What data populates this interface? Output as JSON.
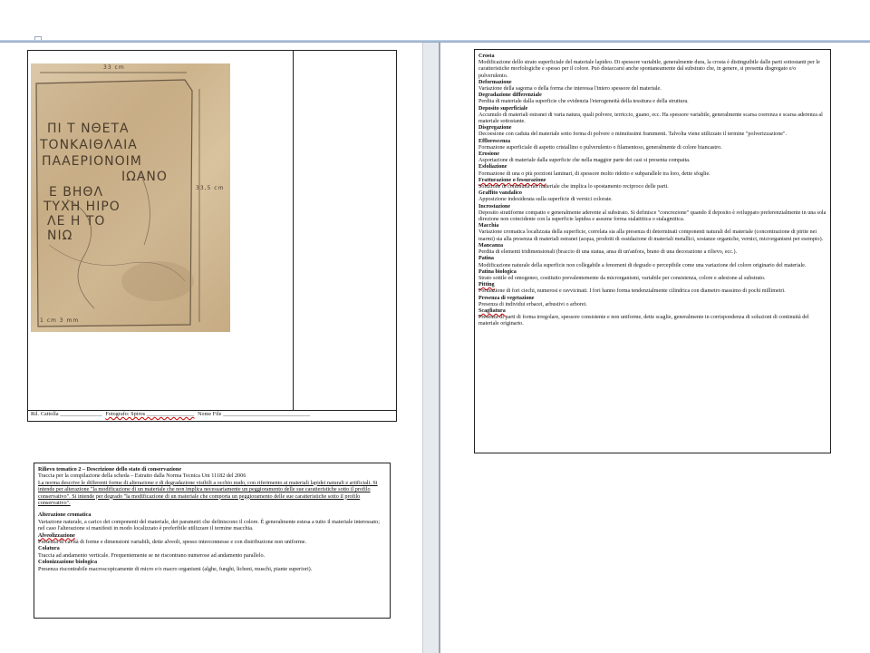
{
  "form": {
    "footer": {
      "ril": "Ril. Cattolla _______________",
      "foto": "Fotografo: Spiros _________________",
      "nome": "Nome File _______________________________"
    }
  },
  "photo": {
    "measure_top": "33 cm",
    "measure_right": "33,5 cm",
    "measure_bottom": "1 cm 3 mm",
    "lines": [
      "ΠΙ Τ ΝΘΕΤΑ",
      "ΤΟΝΚΑΙΘΛΑΙΑ",
      "ΠΑΑΕΡΙΟΝΟΙΜ",
      "ΙΩΑΝΟ",
      "Ε ΒΗΘΛ",
      "ΤΥΧΗ ΗΙΡΟ",
      "ΛΕ Η ΤΟ",
      "ΝΙΩ"
    ]
  },
  "description": {
    "title": "Rilievo tematico 2 – Descrizione dello stato di conservazione",
    "p1": "Traccia per la compilazione della scheda – Estratto dalla Norma Tecnica Uni 11182 del 2006",
    "p2": "La norma descrive le differenti forme di alterazione e di degradazione visibili a occhio nudo,  con riferimento ai materiali lapidei naturali e artificiali. Si intende per alterazione \"la modificazione di un materiale che non implica necessariamente un peggioramento delle sue caratteristiche sotto il profilo conservativo\". Si intende per degrado \"la modificazione di un materiale che comporta un peggioramento delle sue caratteristiche sotto il profilo conservativo\".",
    "items": [
      {
        "term": "Alterazione cromatica",
        "def": "Variazione naturale, a carico dei componenti del materiale, dei parametri che definiscono il colore.  È generalmente estesa a tutto il materiale interessato; nel caso l'alterazione si manifesti in modo localizzato è preferibile utilizzare il termine macchia."
      },
      {
        "term": "Alveolizzazione",
        "def": "Presenza di cavità di forme e dimensioni variabili, dette alveoli, spesso interconnesse e con distribuzione non uniforme."
      },
      {
        "term": "Colatura",
        "def": "Traccia ad andamento verticale. Frequentemente se ne riscontrano numerose ad andamento parallelo."
      },
      {
        "term": "Colonizzazione biologica",
        "def": "Presenza riscontrabile macroscopicamente di micro e/o macro organismi (alghe, funghi, licheni, muschi, piante superiori)."
      }
    ]
  },
  "glossary": [
    {
      "term": "Crosta",
      "def": "Modificazione dello strato superficiale del materiale lapideo. Di spessore variabile,  generalmente dura, la crosta è distinguibile dalle parti sottostanti per le caratteristiche morfologiche e spesso per il colore. Può distaccarsi anche spontaneamente dal substrato che, in genere, si presenta disgregato e/o pulverulento."
    },
    {
      "term": "Deformazione",
      "def": "Variazione della sagoma o della forma che interessa l'intero spessore del materiale."
    },
    {
      "term": "Degradazione differenziale",
      "def": "Perdita di materiale dalla superficie che evidenzia l'eterogeneità della tessitura e della struttura."
    },
    {
      "term": "Deposito superficiale",
      "def": "Accumulo di materiali estranei di varia natura, quali polvere, terriccio, guano, ecc. Ha spessore variabile, generalmente scarsa coerenza e scarsa aderenza al materiale sottostante."
    },
    {
      "term": "Disgregazione",
      "def": "Decoesione con caduta del materiale sotto forma di polvere o minutissimi frammenti. Talvolta viene utilizzato il termine \"polverizzazione\"."
    },
    {
      "term": "Efflorescenza",
      "def": "Formazione superficiale di aspetto cristallino o pulverulento o filamentoso, generalmente di colore biancastro."
    },
    {
      "term": "Erosione",
      "def": "Asportazione di materiale dalla superficie che nella maggior parte dei casi si presenta compatta."
    },
    {
      "term": "Esfoliazione",
      "def": "Formazione di una o più porzioni laminari, di spessore molto ridotto e subparallele tra loro, dette sfoglie."
    },
    {
      "term": "Fratturazione o fessurazione",
      "def": "Soluzione di continuità nel materiale che implica lo spostamento reciproco delle parti."
    },
    {
      "term": "Graffito vandalico",
      "def": "Apposizione indesiderata sulla superficie di vernici colorate."
    },
    {
      "term": "Incrostazione",
      "def": "Deposito stratiforme compatto e generalmente aderente al substrato. Si definisce \"concrezione\" quando il deposito è sviluppato preferenzialmente in una sola direzione non coincidente con la superficie lapidea e assume forma stalattitica o stalagmitica."
    },
    {
      "term": "Macchia",
      "def": "Variazione cromatica localizzata della superficie, correlata sia alla presenza di determinati componenti naturali del materiale (concentrazione di pirite nei marmi) sia alla presenza di materiali estranei (acqua, prodotti di ossidazione di materiali metallici, sostanze organiche, vernici, microrganismi per esempio)."
    },
    {
      "term": "Mancanza",
      "def": "Perdita di elementi tridimensionali (braccio di una statua, ansa di un'anfora, brano di una decorazione a rilievo, ecc.)."
    },
    {
      "term": "Patina",
      "def": "Modificazione naturale della superficie non collegabile a fenomeni di degrado e percepibile come una variazione del colore originario del materiale."
    },
    {
      "term": "Patina biologica",
      "def": "Strato sottile ed omogeneo, costituito prevalentemente da microrganismi, variabile per consistenza, colore e adesione al substrato."
    },
    {
      "term": "Pitting",
      "def": "Formazione di fori ciechi, numerosi e ravvicinati. I fori hanno forma tendenzialmente cilindrica con diametro massimo di pochi millimetri."
    },
    {
      "term": "Presenza di vegetazione",
      "def": "Presenza di individui erbacei, arbustivi o arborei."
    },
    {
      "term": "Scagliatura",
      "def": "Presenza di parti di forma irregolare, spessore consistente e non uniforme, dette scaglie, generalmente in corrispondenza di soluzioni di continuità del materiale originario."
    }
  ]
}
